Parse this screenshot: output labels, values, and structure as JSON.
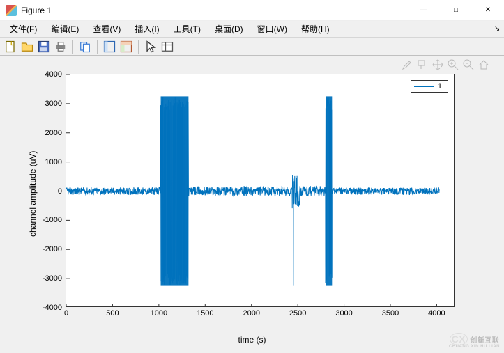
{
  "window": {
    "title": "Figure 1",
    "minimize": "—",
    "maximize": "□",
    "close": "✕"
  },
  "menu": {
    "file": "文件(F)",
    "edit": "编辑(E)",
    "view": "查看(V)",
    "insert": "插入(I)",
    "tools": "工具(T)",
    "desktop": "桌面(D)",
    "window": "窗口(W)",
    "help": "帮助(H)",
    "dock": "↘"
  },
  "toolbar": {
    "new": "new-figure-icon",
    "open": "open-icon",
    "save": "save-icon",
    "print": "print-icon",
    "copy": "copy-icon",
    "layout1": "layout-icon",
    "layout2": "layout2-icon",
    "pointer": "pointer-icon",
    "props": "props-icon"
  },
  "axes_tools": {
    "brush": "brush-icon",
    "datatip": "datatip-icon",
    "pan": "pan-icon",
    "zoomin": "zoom-in-icon",
    "zoomout": "zoom-out-icon",
    "home": "home-icon"
  },
  "chart_data": {
    "type": "line",
    "title": "",
    "xlabel": "time (s)",
    "ylabel": "channel amplitude (uV)",
    "xlim": [
      0,
      4200
    ],
    "ylim": [
      -4000,
      4000
    ],
    "xticks": [
      0,
      500,
      1000,
      1500,
      2000,
      2500,
      3000,
      3500,
      4000
    ],
    "yticks": [
      -4000,
      -3000,
      -2000,
      -1000,
      0,
      1000,
      2000,
      3000,
      4000
    ],
    "legend": {
      "position": "northeast",
      "entries": [
        "1"
      ]
    },
    "series": [
      {
        "name": "1",
        "color": "#0072bd",
        "description": "Single-channel signal trace with dense bursts; values read from axis ticks.",
        "segments": [
          {
            "x_start": 0,
            "x_end": 1020,
            "baseline": 0,
            "noise_amp": 130
          },
          {
            "x_start": 1020,
            "x_end": 1320,
            "baseline": 0,
            "noise_amp": 3250,
            "type": "saturated-burst"
          },
          {
            "x_start": 1320,
            "x_end": 2440,
            "baseline": 0,
            "noise_amp": 160
          },
          {
            "x_start": 2440,
            "x_end": 2520,
            "baseline": 0,
            "noise_amp": 600,
            "type": "spike-group",
            "spikes": [
              -3250,
              520
            ]
          },
          {
            "x_start": 2520,
            "x_end": 2800,
            "baseline": 0,
            "noise_amp": 180
          },
          {
            "x_start": 2800,
            "x_end": 2870,
            "baseline": 0,
            "noise_amp": 3250,
            "type": "narrow-burst"
          },
          {
            "x_start": 2870,
            "x_end": 4030,
            "baseline": 0,
            "noise_amp": 120
          }
        ]
      }
    ]
  },
  "watermark": {
    "big": "创新互联",
    "small": "CHUANG XIN HU LIAN",
    "logo": "CX"
  }
}
